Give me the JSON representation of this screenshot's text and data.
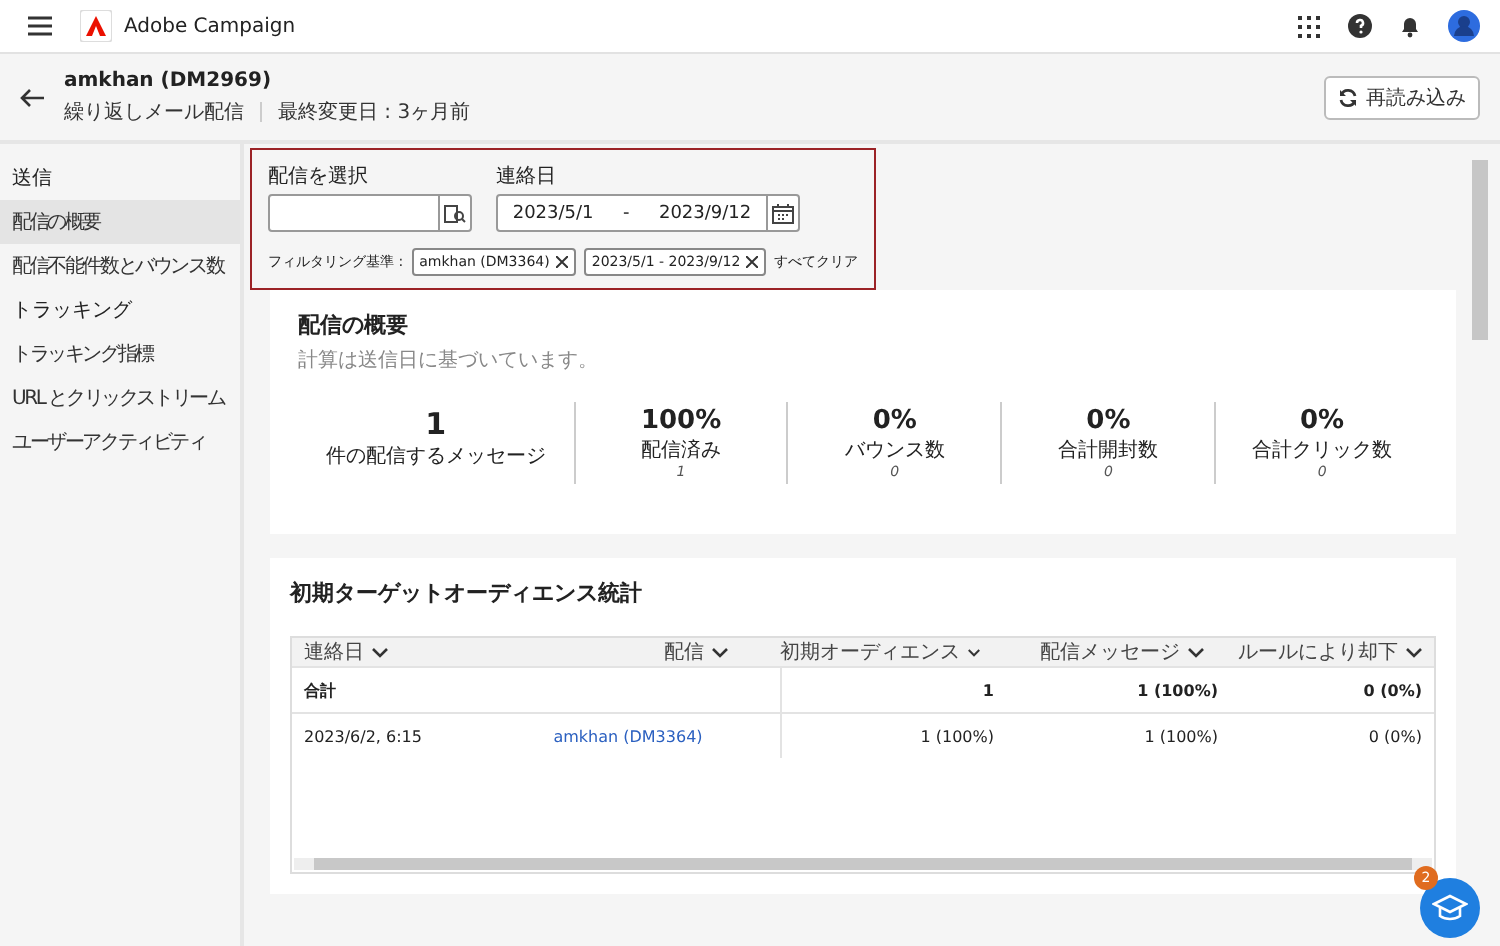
{
  "app": {
    "name": "Adobe Campaign",
    "notification_count": "2"
  },
  "header": {
    "title": "amkhan (DM2969)",
    "subtitle": "繰り返しメール配信",
    "modified": "最終変更日 : 3ヶ月前",
    "reload_button": "再読み込み"
  },
  "sidebar": {
    "sections": [
      {
        "label": "送信",
        "items": [
          {
            "label": "配信の概要",
            "selected": true
          },
          {
            "label": "配信不能件数とバウンス数",
            "selected": false
          }
        ]
      },
      {
        "label": "トラッキング",
        "items": [
          {
            "label": "トラッキング指標",
            "selected": false
          },
          {
            "label": "URL とクリックストリーム",
            "selected": false
          },
          {
            "label": "ユーザーアクティビティ",
            "selected": false
          }
        ]
      }
    ]
  },
  "filters": {
    "delivery_label": "配信を選択",
    "date_label": "連絡日",
    "date_from": "2023/5/1",
    "date_sep": "-",
    "date_to": "2023/9/12",
    "filter_label": "フィルタリング基準 :",
    "tags": [
      {
        "label": "amkhan (DM3364)"
      },
      {
        "label": "2023/5/1 - 2023/9/12"
      }
    ],
    "clear_all": "すべてクリア"
  },
  "summary": {
    "title": "配信の概要",
    "subtitle": "計算は送信日に基づいています。",
    "kpis": [
      {
        "value": "1",
        "label": "件の配信するメッセージ"
      },
      {
        "value": "100%",
        "label": "配信済み",
        "count": "1"
      },
      {
        "value": "0%",
        "label": "バウンス数",
        "count": "0"
      },
      {
        "value": "0%",
        "label": "合計開封数",
        "count": "0"
      },
      {
        "value": "0%",
        "label": "合計クリック数",
        "count": "0"
      }
    ]
  },
  "audience": {
    "title": "初期ターゲットオーディエンス統計",
    "columns": [
      "連絡日",
      "配信",
      "初期オーディエンス",
      "配信メッセージ",
      "ルールにより却下"
    ],
    "rows": [
      {
        "kind": "total",
        "cells": [
          "合計",
          "",
          "1",
          "1 (100%)",
          "0 (0%)"
        ]
      },
      {
        "kind": "data",
        "cells": [
          "2023/6/2, 6:15",
          "amkhan (DM3364)",
          "1 (100%)",
          "1 (100%)",
          "0 (0%)"
        ]
      }
    ]
  }
}
